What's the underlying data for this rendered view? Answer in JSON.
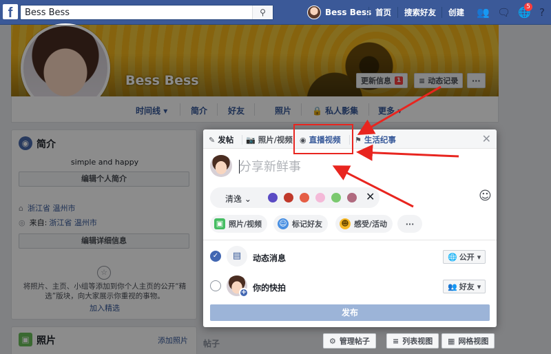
{
  "colors": {
    "brand": "#3b5998",
    "link": "#365899",
    "annotation": "#e8251f",
    "notif": "#fa3e3e"
  },
  "topbar": {
    "logo": "f",
    "search_value": "Bess Bess",
    "user_name": "Bess Bess",
    "links": [
      "首页",
      "搜索好友",
      "创建"
    ],
    "notification_count": "5"
  },
  "profile": {
    "name": "Bess Bess",
    "update_info_label": "更新信息",
    "update_info_count": "1",
    "activity_log_label": "动态记录",
    "more_dots": "···",
    "nav": [
      "时间线",
      "简介",
      "好友",
      "照片",
      "私人影集",
      "更多"
    ]
  },
  "intro": {
    "title": "简介",
    "bio": "simple and happy",
    "edit_bio": "编辑个人简介",
    "lives_in": "浙江省 温州市",
    "from_label": "来自:",
    "from_value": "浙江省 温州市",
    "edit_details": "编辑详细信息",
    "featured_text": "将照片、主页、小组等添加到你个人主页的公开“精选”版块，向大家展示你重视的事物。",
    "featured_link": "加入精选"
  },
  "photos_card": {
    "title": "照片",
    "add_link": "添加照片"
  },
  "composer": {
    "tabs": [
      "发帖",
      "照片/视频",
      "直播视频",
      "生活纪事"
    ],
    "placeholder": "分享新鲜事",
    "background_select": "清逸",
    "swatches": [
      "#5b4bc4",
      "#c0392b",
      "#e55e45",
      "#f4b9d8",
      "#7bc96f",
      "#b06a7f"
    ],
    "actions": [
      "照片/视频",
      "标记好友",
      "感受/活动",
      "···"
    ],
    "options": [
      {
        "label": "动态消息",
        "privacy": "公开",
        "checked": true
      },
      {
        "label": "你的快拍",
        "privacy": "好友",
        "checked": false
      }
    ],
    "post_label": "发布"
  },
  "bottom": {
    "posts_label": "帖子",
    "manage_posts": "管理帖子",
    "list_view": "列表视图",
    "grid_view": "网格视图"
  }
}
